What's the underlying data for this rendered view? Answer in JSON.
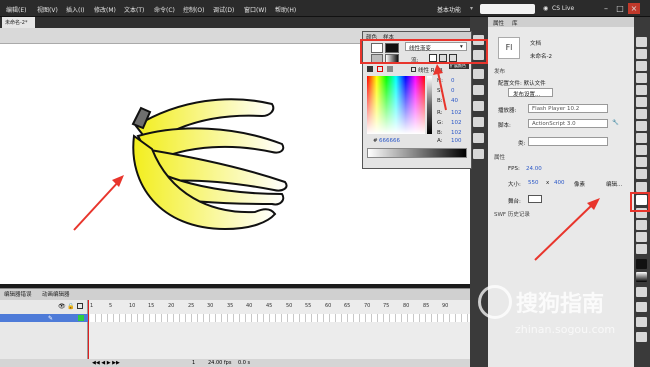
{
  "menubar": {
    "items": [
      {
        "label": "编辑(E)"
      },
      {
        "label": "视图(V)"
      },
      {
        "label": "插入(I)"
      },
      {
        "label": "修改(M)"
      },
      {
        "label": "文本(T)"
      },
      {
        "label": "命令(C)"
      },
      {
        "label": "控制(O)"
      },
      {
        "label": "调试(D)"
      },
      {
        "label": "窗口(W)"
      },
      {
        "label": "帮助(H)"
      }
    ],
    "workspace": "基本功能",
    "cs_live": "CS Live"
  },
  "document": {
    "tab_label": "未命名-2*"
  },
  "timeline": {
    "tabs": [
      "编辑器错误",
      "动画编辑器"
    ],
    "ruler": [
      "1",
      "5",
      "10",
      "15",
      "20",
      "25",
      "30",
      "35",
      "40",
      "45",
      "50",
      "55",
      "60",
      "65",
      "70",
      "75",
      "80",
      "85",
      "90"
    ],
    "fps_readout": "24.00 fps",
    "time_readout": "0.0 s",
    "frame_readout": "1"
  },
  "color_panel": {
    "tab_color": "颜色",
    "tab_swatches": "样本",
    "fill_type": "线性渐变",
    "flow_label": "流:",
    "linear_rgb_label": "线性 RGB",
    "tooltip": "扩展颜色",
    "h_value": "0",
    "s_value": "0",
    "b_value": "40",
    "r_value": "102",
    "g_value": "102",
    "b2_value": "102",
    "hex_value": "666666",
    "alpha_label": "A:",
    "alpha_value": "100"
  },
  "properties": {
    "tab_properties": "属性",
    "tab_library": "库",
    "doc_type_icon": "Fl",
    "doc_type": "文档",
    "doc_name": "未命名-2",
    "section_publish": "发布",
    "config_label": "配置文件: 默认文件",
    "publish_settings": "发布设置...",
    "player_label": "播放器:",
    "player_value": "Flash Player 10.2",
    "script_label": "脚本:",
    "script_value": "ActionScript 3.0",
    "class_label": "类:",
    "section_props": "属性",
    "fps_label": "FPS:",
    "fps_value": "24.00",
    "size_label": "大小:",
    "width": "550",
    "x_label": "x",
    "height": "400",
    "units": "像素",
    "edit_label": "编辑...",
    "stage_label": "舞台:",
    "history_label": "SWF 历史记录"
  },
  "watermark": {
    "brand": "搜狗指南",
    "url": "zhinan.sogou.com"
  },
  "colors": {
    "accent_red": "#e8352c",
    "banana_yellow": "#f6f23a"
  }
}
